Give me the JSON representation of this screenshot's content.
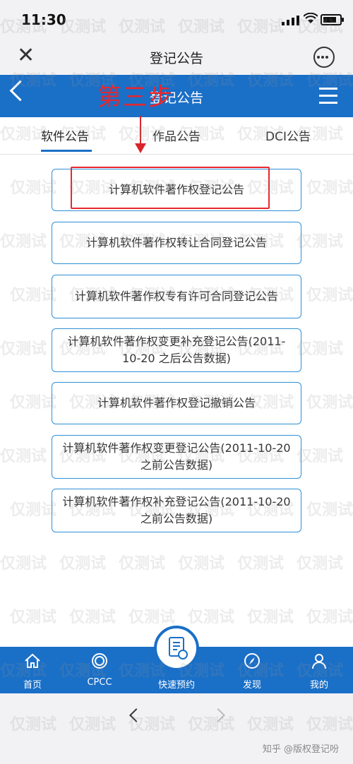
{
  "status_bar": {
    "time": "11:30"
  },
  "webview": {
    "title": "登记公告",
    "close_icon": "close-icon",
    "more_icon": "more-options-icon"
  },
  "blue_header": {
    "title": "登记公告",
    "overlay_text": "第三步",
    "back_icon": "back-arrow-icon",
    "menu_icon": "hamburger-icon"
  },
  "tabs": [
    {
      "label": "软件公告",
      "active": true
    },
    {
      "label": "作品公告",
      "active": false
    },
    {
      "label": "DCI公告",
      "active": false
    }
  ],
  "announcements": [
    {
      "label": "计算机软件著作权登记公告"
    },
    {
      "label": "计算机软件著作权转让合同登记公告"
    },
    {
      "label": "计算机软件著作权专有许可合同登记公告"
    },
    {
      "label": "计算机软件著作权变更补充登记公告(2011-10-20 之后公告数据)"
    },
    {
      "label": "计算机软件著作权登记撤销公告"
    },
    {
      "label": "计算机软件著作权变更登记公告(2011-10-20 之前公告数据)"
    },
    {
      "label": "计算机软件著作权补充登记公告(2011-10-20 之前公告数据)"
    }
  ],
  "bottom_nav": {
    "home": "首页",
    "cpcc": "CPCC",
    "quick": "快速预约",
    "discover": "发现",
    "mine": "我的"
  },
  "watermark": {
    "text": "仅测试",
    "credit": "知乎 @版权登记吩"
  },
  "colors": {
    "primary": "#1a6fc7",
    "annotation": "#e8272d",
    "item_border": "#2f8fd6"
  }
}
